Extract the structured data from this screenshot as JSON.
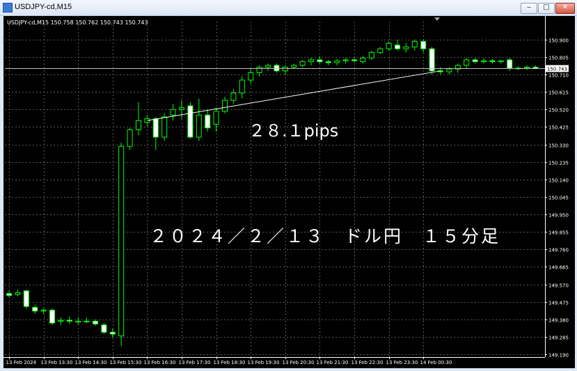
{
  "window": {
    "title": "USDJPY-cd,M15",
    "min_label": "‒",
    "max_label": "□",
    "close_label": "✕"
  },
  "chart_header": "USDJPY-cd,M15  150.758 150.762 150.743 150.743",
  "annotations": {
    "pips": "２８.１pips",
    "caption": "２０２４／２／１３　ドル円　１５分足"
  },
  "colors": {
    "background": "#000000",
    "bull": "#00ff00",
    "bear_body": "#ffffff",
    "grid": "#5a5a5a",
    "axis_text": "#ffffff",
    "bid_line": "#c0c0c0",
    "trend_line": "#ffffff"
  },
  "chart_data": {
    "type": "candlestick",
    "symbol": "USDJPY-cd",
    "timeframe": "M15",
    "current_price": "150.743",
    "ylim": [
      149.175,
      150.96
    ],
    "y_ticks": [
      "150.900",
      "150.805",
      "150.710",
      "150.615",
      "150.520",
      "150.425",
      "150.330",
      "150.235",
      "150.140",
      "150.045",
      "149.950",
      "149.855",
      "149.760",
      "149.665",
      "149.570",
      "149.475",
      "149.380",
      "149.285",
      "149.190"
    ],
    "x_ticks": [
      "13 Feb 2024",
      "13 Feb 13:30",
      "13 Feb 14:30",
      "13 Feb 15:30",
      "13 Feb 16:30",
      "13 Feb 17:30",
      "13 Feb 18:30",
      "13 Feb 19:30",
      "13 Feb 20:30",
      "13 Feb 21:30",
      "13 Feb 22:30",
      "13 Feb 23:30",
      "14 Feb 00:30"
    ],
    "candles": [
      {
        "o": 149.52,
        "h": 149.535,
        "l": 149.5,
        "c": 149.51
      },
      {
        "o": 149.515,
        "h": 149.54,
        "l": 149.505,
        "c": 149.525
      },
      {
        "o": 149.535,
        "h": 149.54,
        "l": 149.44,
        "c": 149.45
      },
      {
        "o": 149.445,
        "h": 149.46,
        "l": 149.41,
        "c": 149.425
      },
      {
        "o": 149.425,
        "h": 149.44,
        "l": 149.41,
        "c": 149.43
      },
      {
        "o": 149.43,
        "h": 149.44,
        "l": 149.35,
        "c": 149.36
      },
      {
        "o": 149.37,
        "h": 149.39,
        "l": 149.35,
        "c": 149.375
      },
      {
        "o": 149.375,
        "h": 149.395,
        "l": 149.355,
        "c": 149.37
      },
      {
        "o": 149.365,
        "h": 149.39,
        "l": 149.35,
        "c": 149.37
      },
      {
        "o": 149.37,
        "h": 149.39,
        "l": 149.36,
        "c": 149.37
      },
      {
        "o": 149.37,
        "h": 149.38,
        "l": 149.345,
        "c": 149.355
      },
      {
        "o": 149.35,
        "h": 149.36,
        "l": 149.3,
        "c": 149.31
      },
      {
        "o": 149.31,
        "h": 149.33,
        "l": 149.28,
        "c": 149.3
      },
      {
        "o": 149.29,
        "h": 150.34,
        "l": 149.235,
        "c": 150.32
      },
      {
        "o": 150.32,
        "h": 150.42,
        "l": 150.3,
        "c": 150.41
      },
      {
        "o": 150.41,
        "h": 150.56,
        "l": 150.38,
        "c": 150.46
      },
      {
        "o": 150.45,
        "h": 150.49,
        "l": 150.43,
        "c": 150.47
      },
      {
        "o": 150.47,
        "h": 150.48,
        "l": 150.3,
        "c": 150.37
      },
      {
        "o": 150.37,
        "h": 150.5,
        "l": 150.35,
        "c": 150.48
      },
      {
        "o": 150.49,
        "h": 150.55,
        "l": 150.46,
        "c": 150.52
      },
      {
        "o": 150.52,
        "h": 150.57,
        "l": 150.47,
        "c": 150.53
      },
      {
        "o": 150.54,
        "h": 150.56,
        "l": 150.36,
        "c": 150.37
      },
      {
        "o": 150.37,
        "h": 150.58,
        "l": 150.35,
        "c": 150.49
      },
      {
        "o": 150.49,
        "h": 150.52,
        "l": 150.4,
        "c": 150.42
      },
      {
        "o": 150.44,
        "h": 150.53,
        "l": 150.4,
        "c": 150.51
      },
      {
        "o": 150.51,
        "h": 150.59,
        "l": 150.5,
        "c": 150.57
      },
      {
        "o": 150.57,
        "h": 150.63,
        "l": 150.55,
        "c": 150.61
      },
      {
        "o": 150.61,
        "h": 150.7,
        "l": 150.58,
        "c": 150.68
      },
      {
        "o": 150.68,
        "h": 150.74,
        "l": 150.66,
        "c": 150.72
      },
      {
        "o": 150.72,
        "h": 150.76,
        "l": 150.7,
        "c": 150.75
      },
      {
        "o": 150.75,
        "h": 150.77,
        "l": 150.73,
        "c": 150.76
      },
      {
        "o": 150.76,
        "h": 150.77,
        "l": 150.72,
        "c": 150.73
      },
      {
        "o": 150.73,
        "h": 150.76,
        "l": 150.71,
        "c": 150.75
      },
      {
        "o": 150.75,
        "h": 150.77,
        "l": 150.74,
        "c": 150.76
      },
      {
        "o": 150.76,
        "h": 150.79,
        "l": 150.75,
        "c": 150.78
      },
      {
        "o": 150.78,
        "h": 150.8,
        "l": 150.76,
        "c": 150.79
      },
      {
        "o": 150.79,
        "h": 150.81,
        "l": 150.77,
        "c": 150.78
      },
      {
        "o": 150.78,
        "h": 150.79,
        "l": 150.76,
        "c": 150.775
      },
      {
        "o": 150.775,
        "h": 150.795,
        "l": 150.76,
        "c": 150.785
      },
      {
        "o": 150.785,
        "h": 150.8,
        "l": 150.77,
        "c": 150.79
      },
      {
        "o": 150.79,
        "h": 150.8,
        "l": 150.775,
        "c": 150.785
      },
      {
        "o": 150.78,
        "h": 150.81,
        "l": 150.77,
        "c": 150.8
      },
      {
        "o": 150.8,
        "h": 150.84,
        "l": 150.79,
        "c": 150.83
      },
      {
        "o": 150.83,
        "h": 150.86,
        "l": 150.82,
        "c": 150.85
      },
      {
        "o": 150.85,
        "h": 150.89,
        "l": 150.84,
        "c": 150.88
      },
      {
        "o": 150.87,
        "h": 150.9,
        "l": 150.84,
        "c": 150.85
      },
      {
        "o": 150.85,
        "h": 150.88,
        "l": 150.83,
        "c": 150.86
      },
      {
        "o": 150.86,
        "h": 150.9,
        "l": 150.84,
        "c": 150.89
      },
      {
        "o": 150.89,
        "h": 150.9,
        "l": 150.83,
        "c": 150.85
      },
      {
        "o": 150.85,
        "h": 150.86,
        "l": 150.71,
        "c": 150.73
      },
      {
        "o": 150.73,
        "h": 150.75,
        "l": 150.71,
        "c": 150.725
      },
      {
        "o": 150.725,
        "h": 150.75,
        "l": 150.71,
        "c": 150.74
      },
      {
        "o": 150.74,
        "h": 150.77,
        "l": 150.72,
        "c": 150.76
      },
      {
        "o": 150.76,
        "h": 150.8,
        "l": 150.74,
        "c": 150.79
      },
      {
        "o": 150.79,
        "h": 150.8,
        "l": 150.77,
        "c": 150.78
      },
      {
        "o": 150.78,
        "h": 150.8,
        "l": 150.77,
        "c": 150.785
      },
      {
        "o": 150.785,
        "h": 150.795,
        "l": 150.77,
        "c": 150.78
      },
      {
        "o": 150.78,
        "h": 150.79,
        "l": 150.77,
        "c": 150.785
      },
      {
        "o": 150.79,
        "h": 150.8,
        "l": 150.73,
        "c": 150.745
      },
      {
        "o": 150.745,
        "h": 150.755,
        "l": 150.735,
        "c": 150.745
      },
      {
        "o": 150.745,
        "h": 150.76,
        "l": 150.735,
        "c": 150.75
      },
      {
        "o": 150.75,
        "h": 150.76,
        "l": 150.74,
        "c": 150.743
      }
    ],
    "trend_line": {
      "from": {
        "index": 16,
        "price": 150.46
      },
      "to": {
        "index": 50,
        "price": 150.73
      }
    }
  }
}
